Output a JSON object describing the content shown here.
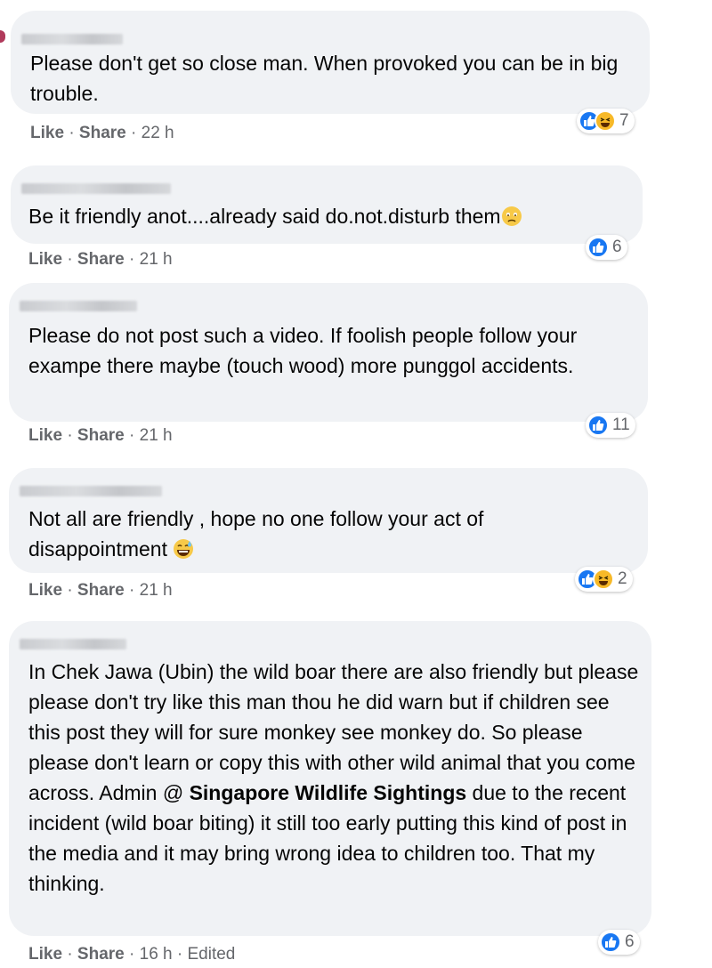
{
  "comments": [
    {
      "text": "Please don't get so close man. When provoked you can be in big trouble.",
      "like": "Like",
      "share": "Share",
      "time": "22 h",
      "reaction_count": "7",
      "reaction_types": [
        "like-icon",
        "haha-icon"
      ]
    },
    {
      "text": "Be it friendly anot....already said do.not.disturb them",
      "text_emoji": "sad-face-emoji",
      "like": "Like",
      "share": "Share",
      "time": "21 h",
      "reaction_count": "6",
      "reaction_types": [
        "like-icon"
      ]
    },
    {
      "text": "Please do not post such a video. If foolish people follow your exampe there maybe (touch wood) more punggol accidents.",
      "like": "Like",
      "share": "Share",
      "time": "21 h",
      "reaction_count": "11",
      "reaction_types": [
        "like-icon"
      ]
    },
    {
      "text": "Not all are friendly , hope no one follow your act of disappointment",
      "text_emoji": "grinning-sweat-emoji",
      "like": "Like",
      "share": "Share",
      "time": "21 h",
      "reaction_count": "2",
      "reaction_types": [
        "like-icon",
        "haha-icon"
      ]
    },
    {
      "text_before": "In Chek Jawa (Ubin) the wild boar there are also friendly but please please don't try like this man thou he did warn but if children see this post they will for sure monkey see monkey do. So please please don't learn or copy this with other wild animal that you come across. Admin @ ",
      "mention": "Singapore Wildlife Sightings",
      "text_after": " due to the recent incident (wild boar biting) it still too early putting this kind of post in the media and it may bring wrong idea to children too. That my thinking.",
      "like": "Like",
      "share": "Share",
      "time": "16 h",
      "edited": "Edited",
      "reaction_count": "6",
      "reaction_types": [
        "like-icon"
      ]
    }
  ],
  "separator": "·",
  "colors": {
    "bubble": "#f0f2f5",
    "text": "#050505",
    "meta": "#65676b",
    "like_blue": "#1877f2",
    "haha_yellow": "#f7b928"
  }
}
